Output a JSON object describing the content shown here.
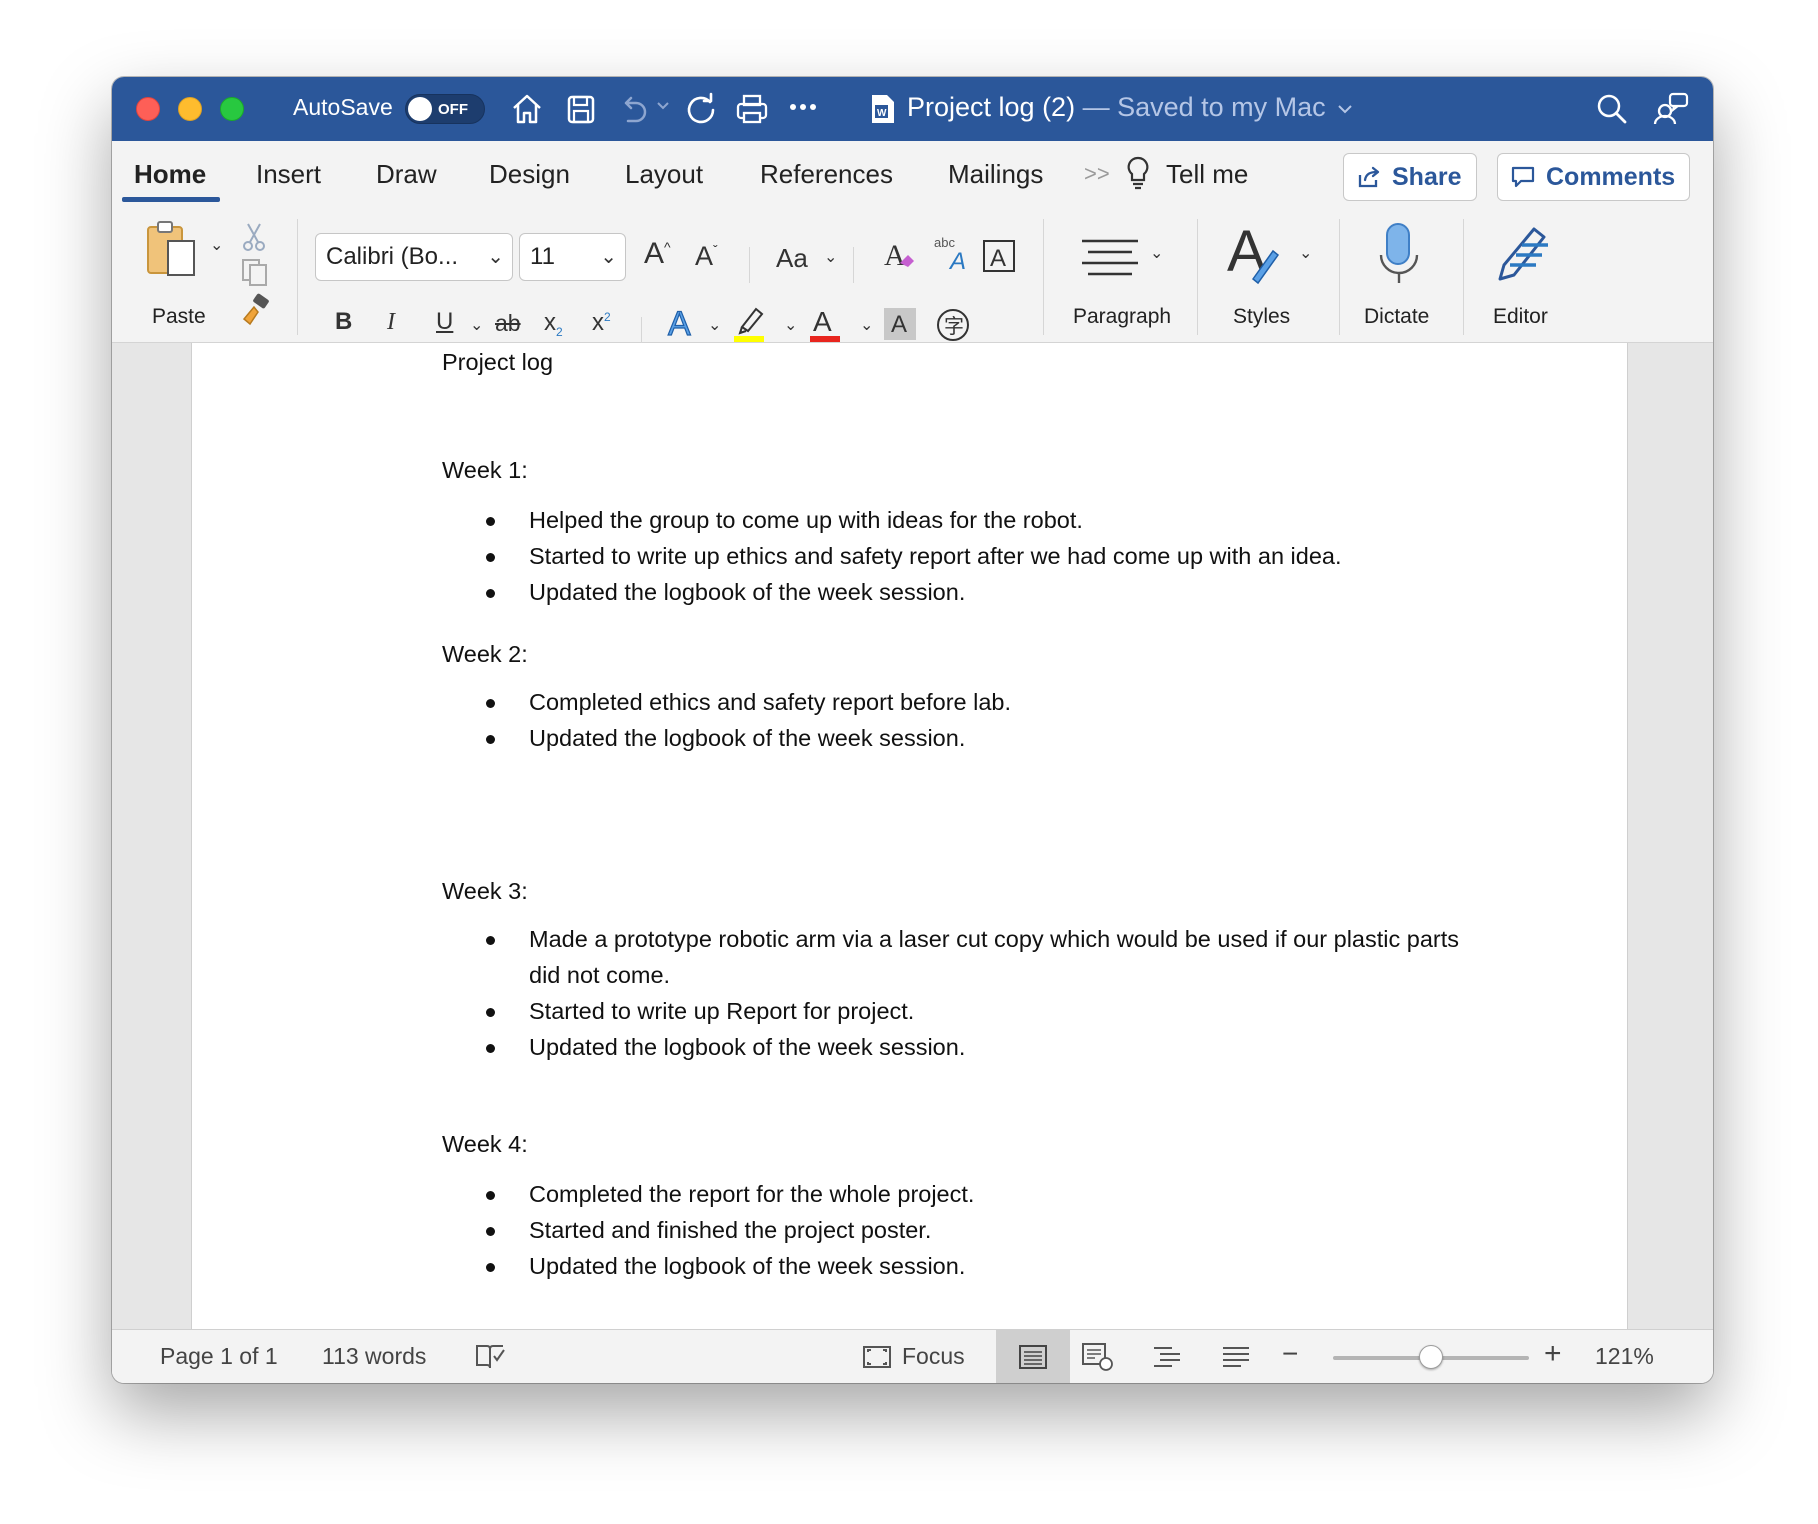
{
  "titlebar": {
    "autosave_label": "AutoSave",
    "autosave_state": "OFF",
    "doc_name": "Project log (2)",
    "doc_status": " — Saved to my Mac",
    "bar_color": "#2b579a"
  },
  "tabs": [
    {
      "label": "Home",
      "active": true
    },
    {
      "label": "Insert"
    },
    {
      "label": "Draw"
    },
    {
      "label": "Design"
    },
    {
      "label": "Layout"
    },
    {
      "label": "References"
    },
    {
      "label": "Mailings"
    }
  ],
  "tellme": "Tell me",
  "share_label": "Share",
  "comments_label": "Comments",
  "ribbon": {
    "paste_label": "Paste",
    "font_name": "Calibri (Bo...",
    "font_size": "11",
    "change_case": "Aa",
    "bold": "B",
    "italic": "I",
    "underline": "U",
    "strike": "ab",
    "subscript": "x",
    "superscript": "x",
    "paragraph_label": "Paragraph",
    "styles_label": "Styles",
    "dictate_label": "Dictate",
    "editor_label": "Editor"
  },
  "document": {
    "title": "Project log",
    "sections": [
      {
        "heading": "Week 1:",
        "items": [
          "Helped the group to come up with ideas for the robot.",
          "Started to write up ethics and safety report after we had come up with an idea.",
          "Updated the logbook of the week session."
        ]
      },
      {
        "heading": "Week 2:",
        "items": [
          "Completed ethics and safety report before lab.",
          "Updated the logbook of the week session."
        ]
      },
      {
        "heading": "Week 3:",
        "items": [
          "Made a prototype robotic arm via a laser cut copy which would be used if our plastic parts",
          "did not come.",
          "Started to write up Report for project.",
          "Updated the logbook of the week session."
        ]
      },
      {
        "heading": "Week 4:",
        "items": [
          "Completed the report for the whole project.",
          "Started and finished the project poster.",
          "Updated the logbook of the week session."
        ]
      }
    ]
  },
  "status": {
    "page": "Page 1 of 1",
    "words": "113 words",
    "focus": "Focus",
    "zoom": "121%",
    "zoom_level": 0.5
  }
}
